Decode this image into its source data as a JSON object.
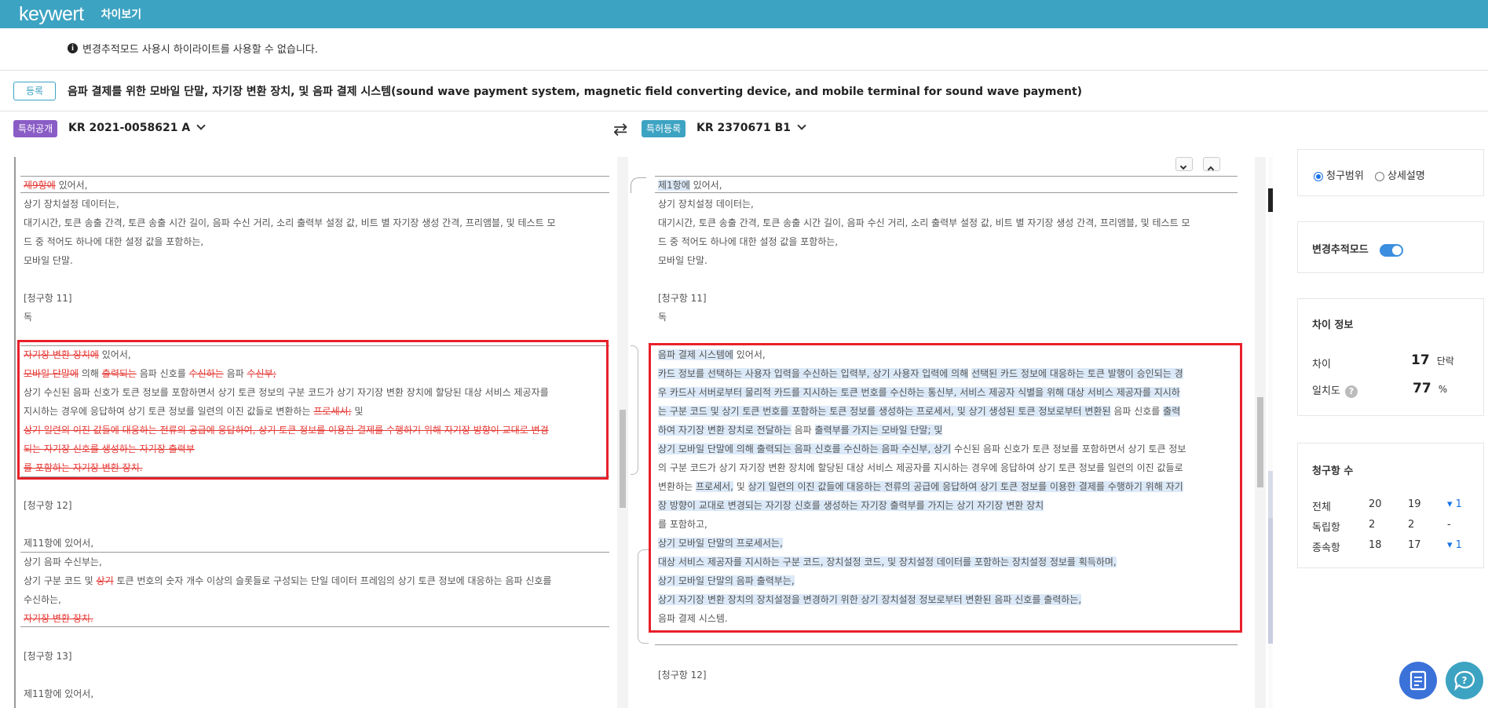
{
  "app": {
    "logo": "keywert",
    "title": "차이보기"
  },
  "notice": {
    "text": "변경추적모드 사용시 하이라이트를 사용할 수 없습니다."
  },
  "document": {
    "register_label": "등록",
    "title": "음파 결제를 위한 모바일 단말, 자기장 변환 장치, 및 음파 결제 시스템(sound wave payment system, magnetic field converting device, and mobile terminal for sound wave payment)"
  },
  "left_doc": {
    "badge": "특허공개",
    "number": "KR 2021-0058621 A"
  },
  "right_doc": {
    "badge": "특허등록",
    "number": "KR 2370671 B1"
  },
  "left": {
    "l1_del": "제9항에",
    "l1_tail": " 있어서,",
    "l2": "상기 장치설정 데이터는,",
    "l3": "대기시간, 토큰 송출 간격, 토큰 송출 시간 길이, 음파 수신 거리, 소리 출력부 설정 값, 비트 별 자기장 생성 간격, 프리앰블, 및 테스트 모",
    "l4": "드 중 적어도 하나에 대한 설정 값을 포함하는,",
    "l5": "모바일 단말.",
    "l6": "[청구항 11]",
    "l7": "독",
    "a1_del": "자기장 변환 장치에",
    "a1_tail": " 있어서,",
    "a2_del1": "모바일 단말에",
    "a2_t1": " 의해 ",
    "a2_del2": "출력되는",
    "a2_t2": " 음파 신호를 ",
    "a2_del3": "수신하는",
    "a2_t3": " 음파 ",
    "a2_del4": "수신부;",
    "a3": "상기 수신된 음파 신호가 토큰 정보를 포함하면서 상기 토큰 정보의 구분 코드가 상기 자기장 변환 장치에 할당된 대상 서비스 제공자를",
    "a4_t1": "지시하는 경우에 응답하여 상기 토큰 정보를 일련의 이진 값들로 변환하는 ",
    "a4_del": "프로세서;",
    "a4_t2": " 및",
    "a5_del": "상기 일련의 이진 값들에 대응하는 전류의 공급에 응답하여, 상기 토큰 정보를 이용한 결제를 수행하기 위해 자기장 방향이 교대로 변경",
    "a6_del": "되는 자기장 신호를 생성하는 자기장 출력부",
    "a7_del": "를 포함하는 자기장 변환 장치.",
    "b1": "[청구항 12]",
    "b2": "제11항에 있어서,",
    "b3": "상기 음파 수신부는,",
    "b4_t1": "상기 구분 코드 및 ",
    "b4_del": "상기",
    "b4_t2": " 토큰 번호의 숫자 개수 이상의 슬롯들로 구성되는 단일 데이터 프레임의 상기 토큰 정보에 대응하는 음파 신호를",
    "b5": "수신하는,",
    "b6_del": "자기장 변환 장치.",
    "c1": "[청구항 13]",
    "c2": "제11항에 있어서,"
  },
  "right": {
    "l1_hl": "제1항에",
    "l1_tail": " 있어서,",
    "l2": "상기 장치설정 데이터는,",
    "l3": "대기시간, 토큰 송출 간격, 토큰 송출 시간 길이, 음파 수신 거리, 소리 출력부 설정 값, 비트 별 자기장 생성 간격, 프리앰블, 및 테스트 모",
    "l4": "드 중 적어도 하나에 대한 설정 값을 포함하는,",
    "l5": "모바일 단말.",
    "l6": "[청구항 11]",
    "l7": "독",
    "a1_hl": "음파 결제 시스템에",
    "a1_tail": " 있어서,",
    "a2_hl": "카드 정보를 선택하는 사용자 입력을 수신하는 입력부, 상기 사용자 입력에 의해",
    "a2_t": " ",
    "a2_hl2": "선택된 카드 정보에 대응하는 토큰 발행이 승인되는 경",
    "a3_hl": "우 카드사 서버로부터 물리적 카드를 지시하는 토큰 번호를 수신하는 통신부, 서비스 제공자 식별을 위해 대상 서비스 제공자를 지시하",
    "a4_hl": "는 구분 코드 및 상기 토큰 번호를 포함하는 토큰 정보를 생성하는 프로세서, 및 상기 생성된 토큰 정보로부터 변환된",
    "a4_t": " 음파 신호를 ",
    "a4_hl2": "출력",
    "a5_hl": "하여 자기장 변환 장치로 전달하는",
    "a5_t": " 음파 ",
    "a5_hl2": "출력부를 가지는 모바일 단말; 및",
    "a6_hl": "상기 모바일 단말에 의해 출력되는 음파 신호를 수신하는 음파 수신부, 상기",
    "a6_t": " 수신된 음파 신호가 토큰 정보를 포함하면서 상기 토큰 정보",
    "a7": "의 구분 코드가 상기 자기장 변환 장치에 할당된 대상 서비스 제공자를 지시하는 경우에 응답하여 상기 토큰 정보를 일련의 이진 값들로",
    "a8_t": "변환하는 ",
    "a8_hl": "프로세서,",
    "a8_t2": " 및 ",
    "a8_hl2": "상기 일련의 이진 값들에 대응하는 전류의 공급에 응답하여 상기 토큰 정보를 이용한 결제를 수행하기 위해 자기",
    "a9_hl": "장 방향이 교대로 변경되는 자기장 신호를 생성하는 자기장 출력부를 가지는 상기 자기장 변환 장치",
    "a10": "를 포함하고,",
    "a11_hl": "상기 모바일 단말의 프로세서는,",
    "a12_hl": "대상 서비스 제공자를 지시하는 구분 코드, 장치설정 코드, 및 장치설정 데이터를 포함하는 장치설정 정보를 획득하며,",
    "a13_hl": "상기 모바일 단말의 음파 출력부는,",
    "a14_hl": "상기 자기장 변환 장치의 장치설정을 변경하기 위한 상기 장치설정 정보로부터 변환된 음파 신호를 출력하는,",
    "a15": "음파 결제 시스템.",
    "b1": "[청구항 12]"
  },
  "side": {
    "scope": {
      "opt1": "청구범위",
      "opt2": "상세설명",
      "selected": "청구범위"
    },
    "track": {
      "label": "변경추적모드",
      "on": true
    },
    "diff": {
      "title": "차이 정보",
      "diff_label": "차이",
      "diff_value": "17",
      "diff_unit": "단락",
      "match_label": "일치도",
      "match_value": "77",
      "match_unit": "%",
      "help": "?"
    },
    "claims": {
      "title": "청구항 수",
      "rows": [
        {
          "label": "전체",
          "a": "20",
          "b": "19",
          "d": "▾ 1"
        },
        {
          "label": "독립항",
          "a": "2",
          "b": "2",
          "d": "-"
        },
        {
          "label": "종속항",
          "a": "18",
          "b": "17",
          "d": "▾ 1"
        }
      ]
    }
  },
  "colors": {
    "brand": "#3da3c2",
    "publish": "#8a5cc6",
    "delete": "#e53935",
    "highlight": "#dbe9f8",
    "redbox": "#e8202a"
  }
}
